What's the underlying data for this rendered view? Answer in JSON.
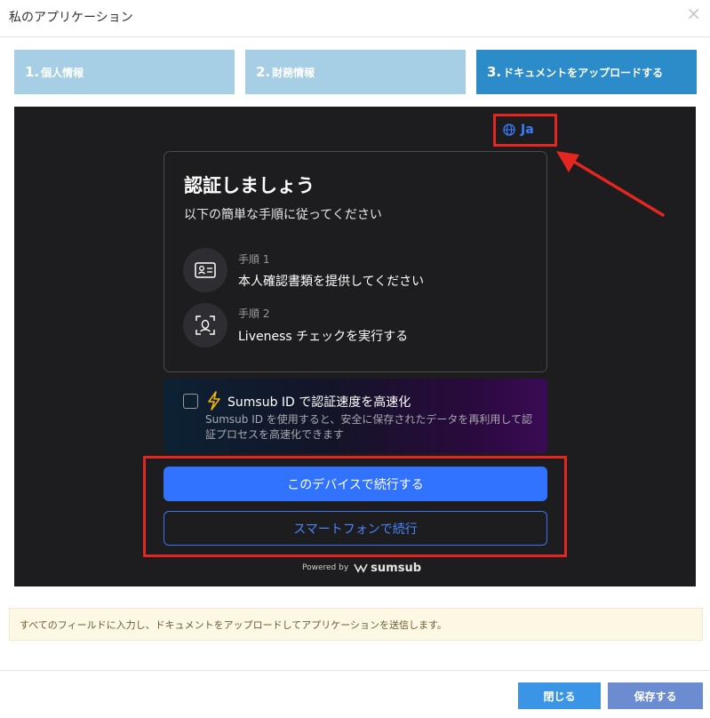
{
  "header": {
    "title": "私のアプリケーション",
    "close_label": "×"
  },
  "steps": [
    {
      "num": "1.",
      "label": "個人情報"
    },
    {
      "num": "2.",
      "label": "財務情報"
    },
    {
      "num": "3.",
      "label": "ドキュメントをアップロードする"
    }
  ],
  "sumsub": {
    "language": "Ja",
    "card": {
      "title": "認証しましょう",
      "subtitle": "以下の簡単な手順に従ってください",
      "steps": [
        {
          "num_label": "手順 1",
          "text": "本人確認書類を提供してください",
          "icon": "id-card-icon"
        },
        {
          "num_label": "手順 2",
          "text": "Liveness チェックを実行する",
          "icon": "face-scan-icon"
        }
      ]
    },
    "promo": {
      "title": "Sumsub ID で認証速度を高速化",
      "description": "Sumsub ID を使用すると、安全に保存されたデータを再利用して認証プロセスを高速化できます"
    },
    "continue_device_label": "このデバイスで続行する",
    "continue_phone_label": "スマートフォンで続行",
    "powered_by": "Powered by",
    "brand": "sumsub"
  },
  "info_message": "すべてのフィールドに入力し、ドキュメントをアップロードしてアプリケーションを送信します。",
  "footer": {
    "close_label": "閉じる",
    "save_label": "保存する"
  },
  "colors": {
    "step_inactive": "#a6cfe5",
    "step_active": "#2c8bc9",
    "panel_bg": "#1d1d1f",
    "sumsub_blue": "#3173ff",
    "annotation_red": "#e3261f",
    "info_bg": "#fcf8e3"
  }
}
